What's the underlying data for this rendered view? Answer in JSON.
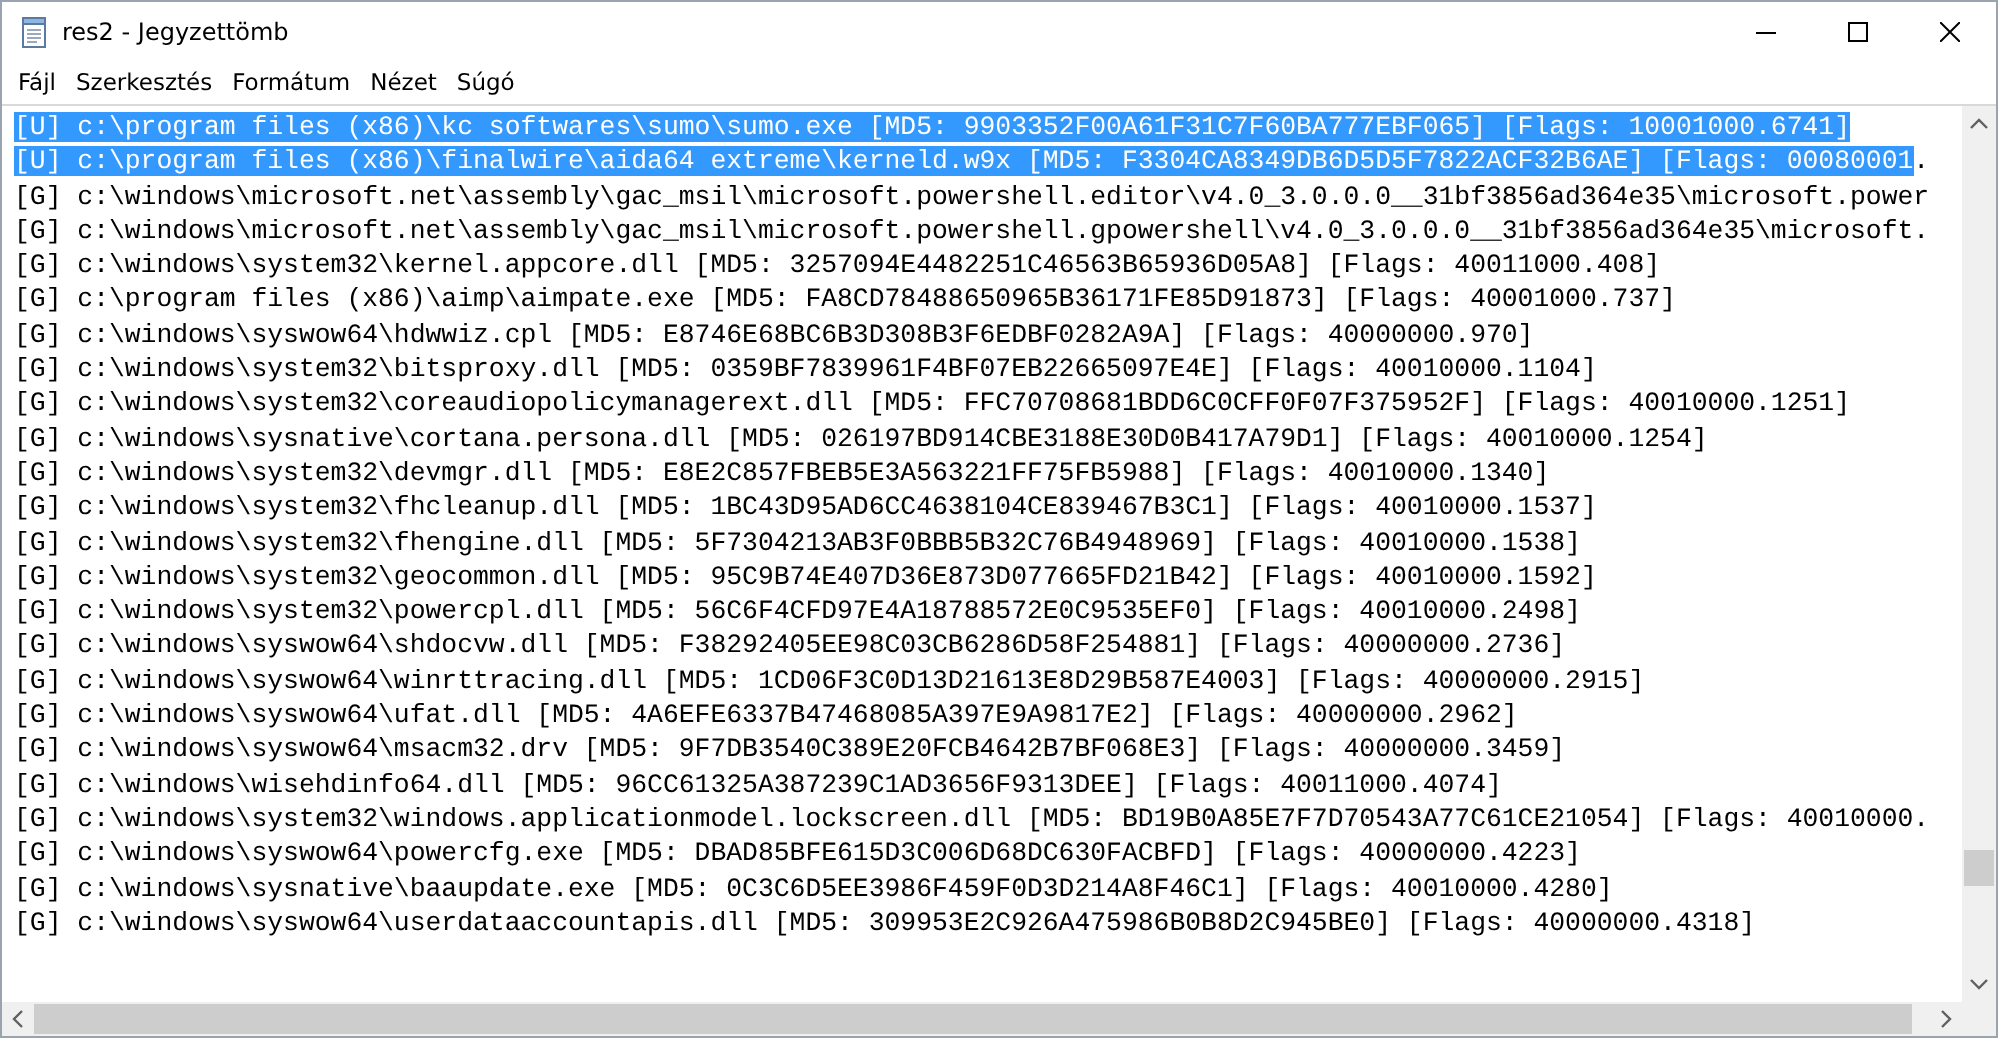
{
  "window": {
    "title": "res2 - Jegyzettömb"
  },
  "menu": [
    "Fájl",
    "Szerkesztés",
    "Formátum",
    "Nézet",
    "Súgó"
  ],
  "lines": [
    {
      "segments": [
        {
          "text": "[U] c:\\program files (x86)\\kc softwares\\sumo\\sumo.exe [MD5: 9903352F00A61F31C7F60BA777EBF065] [Flags: 10001000.6741]",
          "selected": true
        }
      ]
    },
    {
      "segments": [
        {
          "text": "[U] c:\\program files (x86)\\finalwire\\aida64 extreme\\kerneld.w9x [MD5: F3304CA8349DB6D5D5F7822ACF32B6AE] [Flags: 00080001",
          "selected": true
        },
        {
          "text": ".",
          "selected": false
        }
      ]
    },
    {
      "segments": [
        {
          "text": "[G] c:\\windows\\microsoft.net\\assembly\\gac_msil\\microsoft.powershell.editor\\v4.0_3.0.0.0__31bf3856ad364e35\\microsoft.power",
          "selected": false
        }
      ]
    },
    {
      "segments": [
        {
          "text": "[G] c:\\windows\\microsoft.net\\assembly\\gac_msil\\microsoft.powershell.gpowershell\\v4.0_3.0.0.0__31bf3856ad364e35\\microsoft.",
          "selected": false
        }
      ]
    },
    {
      "segments": [
        {
          "text": "[G] c:\\windows\\system32\\kernel.appcore.dll [MD5: 3257094E4482251C46563B65936D05A8] [Flags: 40011000.408]",
          "selected": false
        }
      ]
    },
    {
      "segments": [
        {
          "text": "[G] c:\\program files (x86)\\aimp\\aimpate.exe [MD5: FA8CD78488650965B36171FE85D91873] [Flags: 40001000.737]",
          "selected": false
        }
      ]
    },
    {
      "segments": [
        {
          "text": "[G] c:\\windows\\syswow64\\hdwwiz.cpl [MD5: E8746E68BC6B3D308B3F6EDBF0282A9A] [Flags: 40000000.970]",
          "selected": false
        }
      ]
    },
    {
      "segments": [
        {
          "text": "[G] c:\\windows\\system32\\bitsproxy.dll [MD5: 0359BF7839961F4BF07EB22665097E4E] [Flags: 40010000.1104]",
          "selected": false
        }
      ]
    },
    {
      "segments": [
        {
          "text": "[G] c:\\windows\\system32\\coreaudiopolicymanagerext.dll [MD5: FFC70708681BDD6C0CFF0F07F375952F] [Flags: 40010000.1251]",
          "selected": false
        }
      ]
    },
    {
      "segments": [
        {
          "text": "[G] c:\\windows\\sysnative\\cortana.persona.dll [MD5: 026197BD914CBE3188E30D0B417A79D1] [Flags: 40010000.1254]",
          "selected": false
        }
      ]
    },
    {
      "segments": [
        {
          "text": "[G] c:\\windows\\system32\\devmgr.dll [MD5: E8E2C857FBEB5E3A563221FF75FB5988] [Flags: 40010000.1340]",
          "selected": false
        }
      ]
    },
    {
      "segments": [
        {
          "text": "[G] c:\\windows\\system32\\fhcleanup.dll [MD5: 1BC43D95AD6CC4638104CE839467B3C1] [Flags: 40010000.1537]",
          "selected": false
        }
      ]
    },
    {
      "segments": [
        {
          "text": "[G] c:\\windows\\system32\\fhengine.dll [MD5: 5F7304213AB3F0BBB5B32C76B4948969] [Flags: 40010000.1538]",
          "selected": false
        }
      ]
    },
    {
      "segments": [
        {
          "text": "[G] c:\\windows\\system32\\geocommon.dll [MD5: 95C9B74E407D36E873D077665FD21B42] [Flags: 40010000.1592]",
          "selected": false
        }
      ]
    },
    {
      "segments": [
        {
          "text": "[G] c:\\windows\\system32\\powercpl.dll [MD5: 56C6F4CFD97E4A18788572E0C9535EF0] [Flags: 40010000.2498]",
          "selected": false
        }
      ]
    },
    {
      "segments": [
        {
          "text": "[G] c:\\windows\\syswow64\\shdocvw.dll [MD5: F38292405EE98C03CB6286D58F254881] [Flags: 40000000.2736]",
          "selected": false
        }
      ]
    },
    {
      "segments": [
        {
          "text": "[G] c:\\windows\\syswow64\\winrttracing.dll [MD5: 1CD06F3C0D13D21613E8D29B587E4003] [Flags: 40000000.2915]",
          "selected": false
        }
      ]
    },
    {
      "segments": [
        {
          "text": "[G] c:\\windows\\syswow64\\ufat.dll [MD5: 4A6EFE6337B47468085A397E9A9817E2] [Flags: 40000000.2962]",
          "selected": false
        }
      ]
    },
    {
      "segments": [
        {
          "text": "[G] c:\\windows\\syswow64\\msacm32.drv [MD5: 9F7DB3540C389E20FCB4642B7BF068E3] [Flags: 40000000.3459]",
          "selected": false
        }
      ]
    },
    {
      "segments": [
        {
          "text": "[G] c:\\windows\\wisehdinfo64.dll [MD5: 96CC61325A387239C1AD3656F9313DEE] [Flags: 40011000.4074]",
          "selected": false
        }
      ]
    },
    {
      "segments": [
        {
          "text": "[G] c:\\windows\\system32\\windows.applicationmodel.lockscreen.dll [MD5: BD19B0A85E7F7D70543A77C61CE21054] [Flags: 40010000.",
          "selected": false
        }
      ]
    },
    {
      "segments": [
        {
          "text": "[G] c:\\windows\\syswow64\\powercfg.exe [MD5: DBAD85BFE615D3C006D68DC630FACBFD] [Flags: 40000000.4223]",
          "selected": false
        }
      ]
    },
    {
      "segments": [
        {
          "text": "[G] c:\\windows\\sysnative\\baaupdate.exe [MD5: 0C3C6D5EE3986F459F0D3D214A8F46C1] [Flags: 40010000.4280]",
          "selected": false
        }
      ]
    },
    {
      "segments": [
        {
          "text": "[G] c:\\windows\\syswow64\\userdataaccountapis.dll [MD5: 309953E2C926A475986B0B8D2C945BE0] [Flags: 40000000.4318]",
          "selected": false
        }
      ]
    }
  ]
}
